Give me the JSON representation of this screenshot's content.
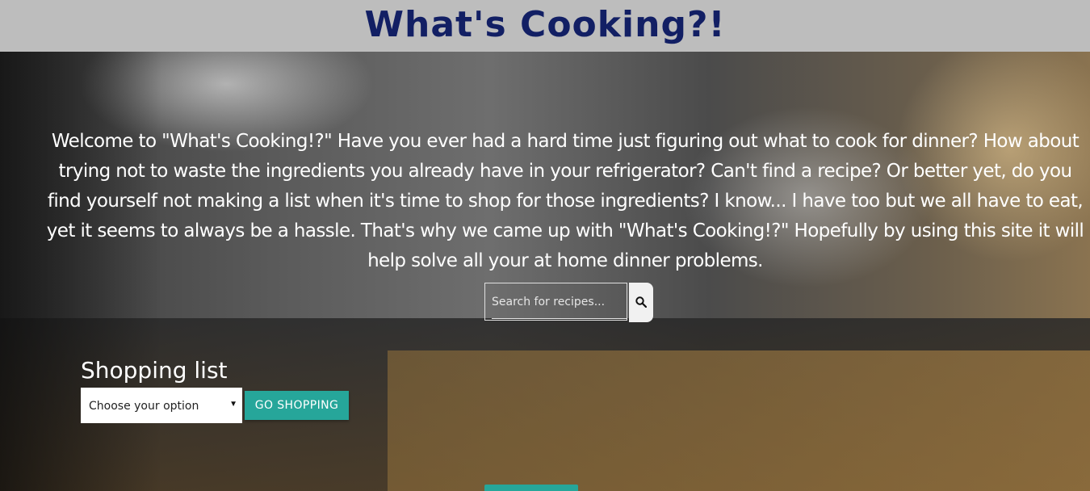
{
  "header": {
    "title": "What's Cooking?!"
  },
  "hero": {
    "intro_text": "Welcome to \"What's Cooking!?\" Have you ever had a hard time just figuring out what to cook for dinner? How about trying not to waste the ingredients you already have in your refrigerator? Can't find a recipe? Or better yet, do you find yourself not making a list when it's time to shop for those ingredients? I know... I have too but we all have to eat, yet it seems to always be a hassle. That's why we came up with \"What's Cooking!?\" Hopefully by using this site it will help solve all your at home dinner problems."
  },
  "search": {
    "placeholder": "Search for recipes...",
    "value": "",
    "button_icon": "search-icon"
  },
  "shopping": {
    "title": "Shopping list",
    "select_value": "Choose your option",
    "button_label": "GO SHOPPING"
  },
  "colors": {
    "header_bg": "#bdbdbd",
    "title_color": "#121f64",
    "accent": "#26a69a",
    "text_on_hero": "#ffffff"
  }
}
